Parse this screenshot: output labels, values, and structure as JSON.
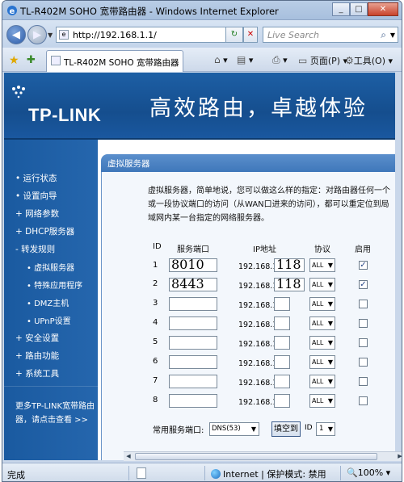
{
  "window": {
    "title": "TL-R402M SOHO 宽带路由器 - Windows Internet Explorer"
  },
  "addressbar": {
    "url": "http://192.168.1.1/",
    "search_placeholder": "Live Search"
  },
  "tabbar": {
    "tab_title": "TL-R402M SOHO 宽带路由器",
    "page_menu": "页面(P)",
    "tools_menu": "工具(O)"
  },
  "banner": {
    "logo": "TP-LINK",
    "slogan": "高效路由，卓越体验"
  },
  "sidebar": {
    "items": [
      {
        "label": "• 运行状态"
      },
      {
        "label": "• 设置向导"
      },
      {
        "label": "+ 网络参数"
      },
      {
        "label": "+ DHCP服务器"
      },
      {
        "label": "- 转发规则"
      },
      {
        "label": "• 虚拟服务器"
      },
      {
        "label": "• 特殊应用程序"
      },
      {
        "label": "• DMZ主机"
      },
      {
        "label": "• UPnP设置"
      },
      {
        "label": "+ 安全设置"
      },
      {
        "label": "+ 路由功能"
      },
      {
        "label": "+ 系统工具"
      }
    ],
    "more": "更多TP-LINK宽带路由器，请点击查看 >>"
  },
  "panel": {
    "title": "虚拟服务器",
    "description": "虚拟服务器，简单地说，您可以做这么样的指定：对路由器任何一个或一段协议端口的访问（从WAN口进来的访问），都可以重定位到局域网内某一台指定的网络服务器。"
  },
  "table": {
    "headers": {
      "id": "ID",
      "port": "服务端口",
      "ip": "IP地址",
      "protocol": "协议",
      "enable": "启用"
    },
    "ip_prefix": "192.168.1.",
    "rows": [
      {
        "id": "1",
        "port": "8010",
        "ip": "118",
        "protocol": "ALL",
        "enabled": true
      },
      {
        "id": "2",
        "port": "8443",
        "ip": "118",
        "protocol": "ALL",
        "enabled": true
      },
      {
        "id": "3",
        "port": "",
        "ip": "",
        "protocol": "ALL",
        "enabled": false
      },
      {
        "id": "4",
        "port": "",
        "ip": "",
        "protocol": "ALL",
        "enabled": false
      },
      {
        "id": "5",
        "port": "",
        "ip": "",
        "protocol": "ALL",
        "enabled": false
      },
      {
        "id": "6",
        "port": "",
        "ip": "",
        "protocol": "ALL",
        "enabled": false
      },
      {
        "id": "7",
        "port": "",
        "ip": "",
        "protocol": "ALL",
        "enabled": false
      },
      {
        "id": "8",
        "port": "",
        "ip": "",
        "protocol": "ALL",
        "enabled": false
      }
    ]
  },
  "common_ports": {
    "label": "常用服务端口:",
    "selected": "DNS(53)",
    "fill_button": "填空到",
    "id_label": "ID",
    "id_selected": "1"
  },
  "statusbar": {
    "status": "完成",
    "zone": "Internet | 保护模式: 禁用",
    "zoom": "100%"
  }
}
